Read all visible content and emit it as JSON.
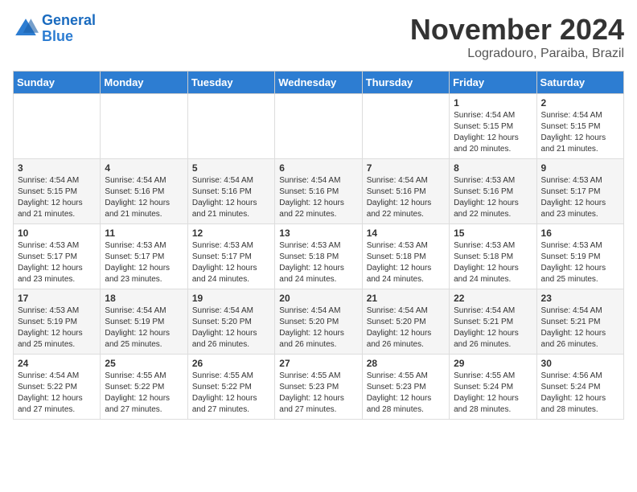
{
  "header": {
    "logo_line1": "General",
    "logo_line2": "Blue",
    "month": "November 2024",
    "location": "Logradouro, Paraiba, Brazil"
  },
  "weekdays": [
    "Sunday",
    "Monday",
    "Tuesday",
    "Wednesday",
    "Thursday",
    "Friday",
    "Saturday"
  ],
  "weeks": [
    [
      {
        "day": "",
        "info": ""
      },
      {
        "day": "",
        "info": ""
      },
      {
        "day": "",
        "info": ""
      },
      {
        "day": "",
        "info": ""
      },
      {
        "day": "",
        "info": ""
      },
      {
        "day": "1",
        "info": "Sunrise: 4:54 AM\nSunset: 5:15 PM\nDaylight: 12 hours and 20 minutes."
      },
      {
        "day": "2",
        "info": "Sunrise: 4:54 AM\nSunset: 5:15 PM\nDaylight: 12 hours and 21 minutes."
      }
    ],
    [
      {
        "day": "3",
        "info": "Sunrise: 4:54 AM\nSunset: 5:15 PM\nDaylight: 12 hours and 21 minutes."
      },
      {
        "day": "4",
        "info": "Sunrise: 4:54 AM\nSunset: 5:16 PM\nDaylight: 12 hours and 21 minutes."
      },
      {
        "day": "5",
        "info": "Sunrise: 4:54 AM\nSunset: 5:16 PM\nDaylight: 12 hours and 21 minutes."
      },
      {
        "day": "6",
        "info": "Sunrise: 4:54 AM\nSunset: 5:16 PM\nDaylight: 12 hours and 22 minutes."
      },
      {
        "day": "7",
        "info": "Sunrise: 4:54 AM\nSunset: 5:16 PM\nDaylight: 12 hours and 22 minutes."
      },
      {
        "day": "8",
        "info": "Sunrise: 4:53 AM\nSunset: 5:16 PM\nDaylight: 12 hours and 22 minutes."
      },
      {
        "day": "9",
        "info": "Sunrise: 4:53 AM\nSunset: 5:17 PM\nDaylight: 12 hours and 23 minutes."
      }
    ],
    [
      {
        "day": "10",
        "info": "Sunrise: 4:53 AM\nSunset: 5:17 PM\nDaylight: 12 hours and 23 minutes."
      },
      {
        "day": "11",
        "info": "Sunrise: 4:53 AM\nSunset: 5:17 PM\nDaylight: 12 hours and 23 minutes."
      },
      {
        "day": "12",
        "info": "Sunrise: 4:53 AM\nSunset: 5:17 PM\nDaylight: 12 hours and 24 minutes."
      },
      {
        "day": "13",
        "info": "Sunrise: 4:53 AM\nSunset: 5:18 PM\nDaylight: 12 hours and 24 minutes."
      },
      {
        "day": "14",
        "info": "Sunrise: 4:53 AM\nSunset: 5:18 PM\nDaylight: 12 hours and 24 minutes."
      },
      {
        "day": "15",
        "info": "Sunrise: 4:53 AM\nSunset: 5:18 PM\nDaylight: 12 hours and 24 minutes."
      },
      {
        "day": "16",
        "info": "Sunrise: 4:53 AM\nSunset: 5:19 PM\nDaylight: 12 hours and 25 minutes."
      }
    ],
    [
      {
        "day": "17",
        "info": "Sunrise: 4:53 AM\nSunset: 5:19 PM\nDaylight: 12 hours and 25 minutes."
      },
      {
        "day": "18",
        "info": "Sunrise: 4:54 AM\nSunset: 5:19 PM\nDaylight: 12 hours and 25 minutes."
      },
      {
        "day": "19",
        "info": "Sunrise: 4:54 AM\nSunset: 5:20 PM\nDaylight: 12 hours and 26 minutes."
      },
      {
        "day": "20",
        "info": "Sunrise: 4:54 AM\nSunset: 5:20 PM\nDaylight: 12 hours and 26 minutes."
      },
      {
        "day": "21",
        "info": "Sunrise: 4:54 AM\nSunset: 5:20 PM\nDaylight: 12 hours and 26 minutes."
      },
      {
        "day": "22",
        "info": "Sunrise: 4:54 AM\nSunset: 5:21 PM\nDaylight: 12 hours and 26 minutes."
      },
      {
        "day": "23",
        "info": "Sunrise: 4:54 AM\nSunset: 5:21 PM\nDaylight: 12 hours and 26 minutes."
      }
    ],
    [
      {
        "day": "24",
        "info": "Sunrise: 4:54 AM\nSunset: 5:22 PM\nDaylight: 12 hours and 27 minutes."
      },
      {
        "day": "25",
        "info": "Sunrise: 4:55 AM\nSunset: 5:22 PM\nDaylight: 12 hours and 27 minutes."
      },
      {
        "day": "26",
        "info": "Sunrise: 4:55 AM\nSunset: 5:22 PM\nDaylight: 12 hours and 27 minutes."
      },
      {
        "day": "27",
        "info": "Sunrise: 4:55 AM\nSunset: 5:23 PM\nDaylight: 12 hours and 27 minutes."
      },
      {
        "day": "28",
        "info": "Sunrise: 4:55 AM\nSunset: 5:23 PM\nDaylight: 12 hours and 28 minutes."
      },
      {
        "day": "29",
        "info": "Sunrise: 4:55 AM\nSunset: 5:24 PM\nDaylight: 12 hours and 28 minutes."
      },
      {
        "day": "30",
        "info": "Sunrise: 4:56 AM\nSunset: 5:24 PM\nDaylight: 12 hours and 28 minutes."
      }
    ]
  ]
}
